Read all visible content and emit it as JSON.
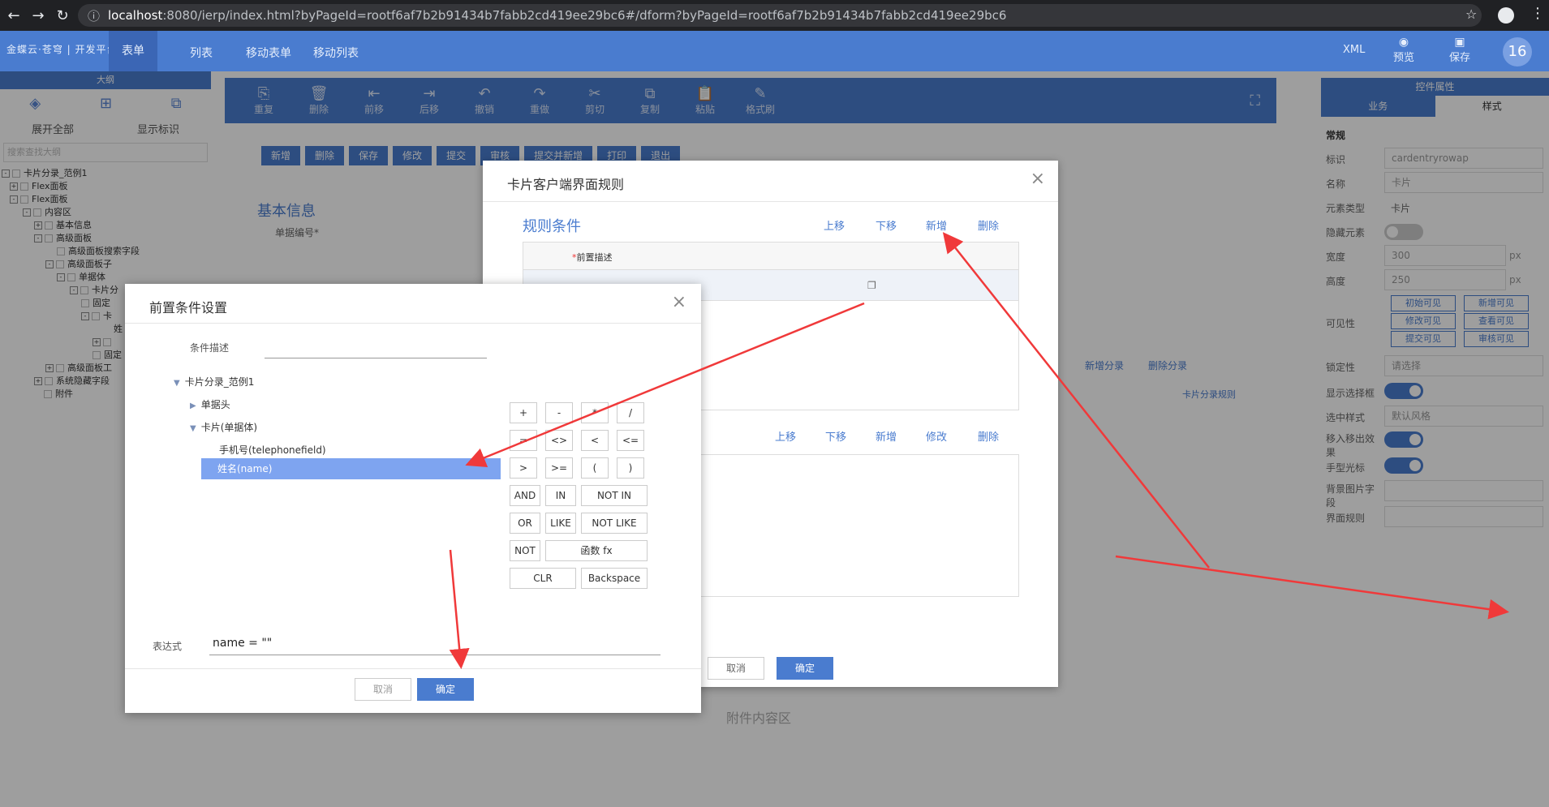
{
  "browser": {
    "url_host": "localhost",
    "url_rest": ":8080/ierp/index.html?byPageId=rootf6af7b2b91434b7fabb2cd419ee29bc6#/dform?byPageId=rootf6af7b2b91434b7fabb2cd419ee29bc6"
  },
  "app": {
    "logo": "金蝶云·苍穹 | 开发平台",
    "tabs": [
      "表单",
      "列表",
      "移动表单",
      "移动列表"
    ],
    "xml": "XML",
    "preview": "预览",
    "save": "保存",
    "user_badge": "16"
  },
  "outline": {
    "title": "大纲",
    "expand_all": "展开全部",
    "show_id": "显示标识",
    "search_placeholder": "搜索查找大纲",
    "tree": [
      "卡片分录_范例1",
      "Flex面板",
      "Flex面板",
      "内容区",
      "基本信息",
      "高级面板",
      "高级面板搜索字段",
      "高级面板子",
      "单据体",
      "卡片分",
      "固定",
      "卡",
      "姓",
      "固定",
      "高级面板工",
      "系统隐藏字段",
      "附件"
    ]
  },
  "toolbar": {
    "items": [
      "重复",
      "删除",
      "前移",
      "后移",
      "撤销",
      "重做",
      "剪切",
      "复制",
      "粘贴",
      "格式刷"
    ]
  },
  "formbar": {
    "buttons": [
      "新增",
      "删除",
      "保存",
      "修改",
      "提交",
      "审核",
      "提交并新增",
      "打印",
      "退出"
    ]
  },
  "form": {
    "section": "基本信息",
    "bill_no": "单据编号*",
    "attach_area": "附件内容区",
    "add_entry": "新增分录",
    "del_entry": "删除分录",
    "card_rule": "卡片分录规则"
  },
  "props": {
    "title": "控件属性",
    "tab_biz": "业务",
    "tab_style": "样式",
    "group": "常规",
    "rows": [
      {
        "label": "标识",
        "value": "cardentryrowap"
      },
      {
        "label": "名称",
        "value": "卡片"
      },
      {
        "label": "元素类型",
        "value": "卡片"
      },
      {
        "label": "隐藏元素",
        "value": ""
      },
      {
        "label": "宽度",
        "value": "300"
      },
      {
        "label": "高度",
        "value": "250"
      },
      {
        "label": "可见性",
        "value": ""
      },
      {
        "label": "锁定性",
        "value": "请选择"
      },
      {
        "label": "显示选择框",
        "value": ""
      },
      {
        "label": "选中样式",
        "value": "默认风格"
      },
      {
        "label": "移入移出效果",
        "value": ""
      },
      {
        "label": "手型光标",
        "value": ""
      },
      {
        "label": "背景图片字段",
        "value": ""
      },
      {
        "label": "界面规则",
        "value": ""
      }
    ],
    "unit": "px",
    "vis": [
      "初始可见",
      "新增可见",
      "修改可见",
      "查看可见",
      "提交可见",
      "审核可见"
    ]
  },
  "rule_dialog": {
    "title": "卡片客户端界面规则",
    "cond_title": "规则条件",
    "up": "上移",
    "down": "下移",
    "add": "新增",
    "del": "删除",
    "edit": "修改",
    "col_front": "前置描述",
    "cancel": "取消",
    "ok": "确定"
  },
  "fc_dialog": {
    "title": "前置条件设置",
    "cond_desc_label": "条件描述",
    "root": "卡片分录_范例1",
    "head": "单据头",
    "card": "卡片(单据体)",
    "phone": "手机号(telephonefield)",
    "name": "姓名(name)",
    "ops": [
      "+",
      "-",
      "*",
      "/",
      "=",
      "<>",
      "<",
      "<=",
      ">",
      ">=",
      "(",
      ")",
      "AND",
      "IN",
      "NOT IN",
      "OR",
      "LIKE",
      "NOT LIKE",
      "NOT",
      "函数 fx",
      "CLR",
      "Backspace"
    ],
    "expr_label": "表达式",
    "expr": "name = \"\"",
    "cancel": "取消",
    "ok": "确定"
  },
  "colors": {
    "accent": "#4a7ccf",
    "arrow": "#f0393a"
  }
}
